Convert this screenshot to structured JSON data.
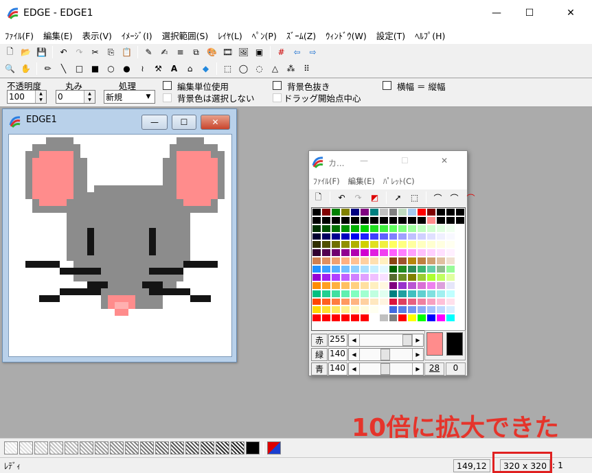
{
  "window": {
    "title": "EDGE - EDGE1",
    "minimize": "—",
    "maximize": "☐",
    "close": "✕"
  },
  "menu": [
    "ﾌｧｲﾙ(F)",
    "編集(E)",
    "表示(V)",
    "ｲﾒｰｼﾞ(I)",
    "選択範囲(S)",
    "ﾚｲﾔ(L)",
    "ﾍﾟﾝ(P)",
    "ｽﾞｰﾑ(Z)",
    "ｳｨﾝﾄﾞｳ(W)",
    "設定(T)",
    "ﾍﾙﾌﾟ(H)"
  ],
  "options": {
    "opacity_label": "不透明度",
    "opacity_value": "100",
    "round_label": "丸み",
    "round_value": "0",
    "process_label": "処理",
    "process_value": "新規",
    "edit_unit": "編集単位使用",
    "bg_not_select": "背景色は選択しない",
    "bg_transparent": "背景色抜き",
    "drag_center": "ドラッグ開始点中心",
    "aspect": "横幅 ＝ 縦幅"
  },
  "child": {
    "title": "EDGE1",
    "minimize": "—",
    "maximize": "☐",
    "close": "✕"
  },
  "palette": {
    "title": "カ...",
    "minimize": "—",
    "maximize": "☐",
    "close": "✕",
    "menu": [
      "ﾌｧｲﾙ(F)",
      "編集(E)",
      "ﾊﾟﾚｯﾄ(C)"
    ],
    "red_label": "赤",
    "red_value": "255",
    "green_label": "緑",
    "green_value": "140",
    "blue_label": "青",
    "blue_value": "140",
    "index_fg": "28",
    "index_bg": "0",
    "fg_color": "#ff8c8c",
    "bg_color": "#000000"
  },
  "status": {
    "mode": "ﾚﾃﾞｨ",
    "coords": "149,12",
    "size": "320 x 320",
    "zoom": "1"
  },
  "caption": "10倍に拡大できた",
  "colors": {
    "mouse_gray": "#8c8c8c",
    "ear_pink": "#ff8c8c",
    "black": "#141414"
  }
}
